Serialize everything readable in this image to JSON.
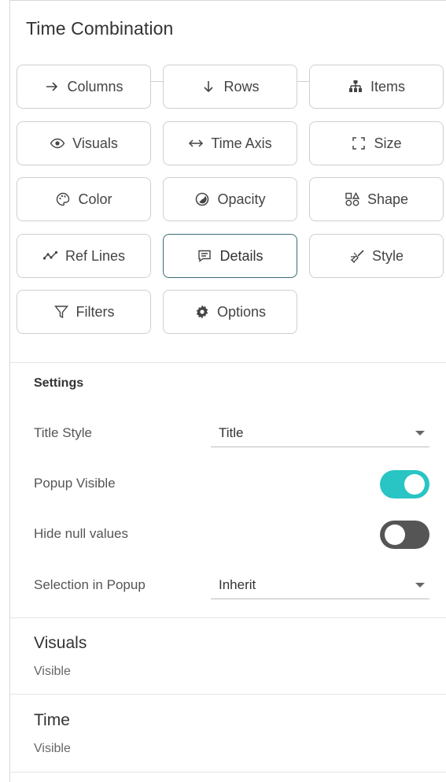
{
  "panel": {
    "title": "Time Combination"
  },
  "buttons": [
    {
      "label": "Columns",
      "icon": "arrow-right-icon"
    },
    {
      "label": "Rows",
      "icon": "arrow-down-icon"
    },
    {
      "label": "Items",
      "icon": "hierarchy-icon"
    },
    {
      "label": "Visuals",
      "icon": "eye-icon"
    },
    {
      "label": "Time Axis",
      "icon": "arrow-left-right-icon"
    },
    {
      "label": "Size",
      "icon": "resize-corners-icon"
    },
    {
      "label": "Color",
      "icon": "palette-icon"
    },
    {
      "label": "Opacity",
      "icon": "opacity-icon"
    },
    {
      "label": "Shape",
      "icon": "shapes-icon"
    },
    {
      "label": "Ref Lines",
      "icon": "line-chart-icon"
    },
    {
      "label": "Details",
      "icon": "comment-icon",
      "active": true
    },
    {
      "label": "Style",
      "icon": "paint-brush-icon"
    },
    {
      "label": "Filters",
      "icon": "filter-icon"
    },
    {
      "label": "Options",
      "icon": "gear-icon"
    }
  ],
  "settings": {
    "heading": "Settings",
    "title_style": {
      "label": "Title Style",
      "value": "Title"
    },
    "popup_visible": {
      "label": "Popup Visible",
      "on": true
    },
    "hide_null": {
      "label": "Hide null values",
      "on": false
    },
    "selection_popup": {
      "label": "Selection in Popup",
      "value": "Inherit"
    }
  },
  "sections": [
    {
      "title": "Visuals",
      "status": "Visible"
    },
    {
      "title": "Time",
      "status": "Visible"
    }
  ],
  "colors": {
    "accent": "#29c4c4",
    "active_border": "#3a6c78",
    "toggle_off": "#555555"
  }
}
